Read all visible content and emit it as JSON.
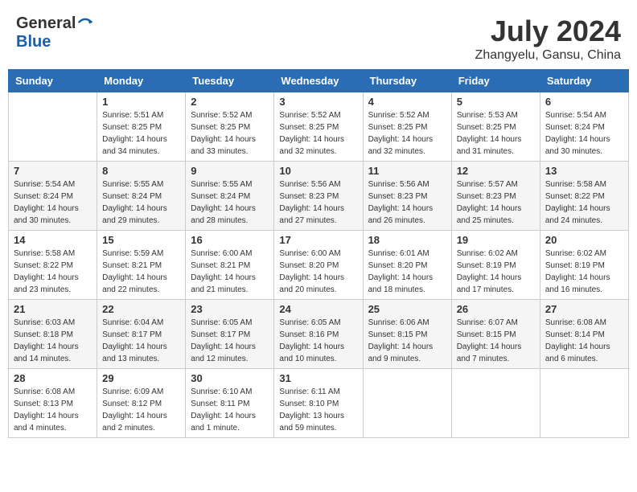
{
  "header": {
    "logo_general": "General",
    "logo_blue": "Blue",
    "title": "July 2024",
    "location": "Zhangyelu, Gansu, China"
  },
  "days_of_week": [
    "Sunday",
    "Monday",
    "Tuesday",
    "Wednesday",
    "Thursday",
    "Friday",
    "Saturday"
  ],
  "weeks": [
    [
      {
        "day": "",
        "info": ""
      },
      {
        "day": "1",
        "info": "Sunrise: 5:51 AM\nSunset: 8:25 PM\nDaylight: 14 hours\nand 34 minutes."
      },
      {
        "day": "2",
        "info": "Sunrise: 5:52 AM\nSunset: 8:25 PM\nDaylight: 14 hours\nand 33 minutes."
      },
      {
        "day": "3",
        "info": "Sunrise: 5:52 AM\nSunset: 8:25 PM\nDaylight: 14 hours\nand 32 minutes."
      },
      {
        "day": "4",
        "info": "Sunrise: 5:52 AM\nSunset: 8:25 PM\nDaylight: 14 hours\nand 32 minutes."
      },
      {
        "day": "5",
        "info": "Sunrise: 5:53 AM\nSunset: 8:25 PM\nDaylight: 14 hours\nand 31 minutes."
      },
      {
        "day": "6",
        "info": "Sunrise: 5:54 AM\nSunset: 8:24 PM\nDaylight: 14 hours\nand 30 minutes."
      }
    ],
    [
      {
        "day": "7",
        "info": "Sunrise: 5:54 AM\nSunset: 8:24 PM\nDaylight: 14 hours\nand 30 minutes."
      },
      {
        "day": "8",
        "info": "Sunrise: 5:55 AM\nSunset: 8:24 PM\nDaylight: 14 hours\nand 29 minutes."
      },
      {
        "day": "9",
        "info": "Sunrise: 5:55 AM\nSunset: 8:24 PM\nDaylight: 14 hours\nand 28 minutes."
      },
      {
        "day": "10",
        "info": "Sunrise: 5:56 AM\nSunset: 8:23 PM\nDaylight: 14 hours\nand 27 minutes."
      },
      {
        "day": "11",
        "info": "Sunrise: 5:56 AM\nSunset: 8:23 PM\nDaylight: 14 hours\nand 26 minutes."
      },
      {
        "day": "12",
        "info": "Sunrise: 5:57 AM\nSunset: 8:23 PM\nDaylight: 14 hours\nand 25 minutes."
      },
      {
        "day": "13",
        "info": "Sunrise: 5:58 AM\nSunset: 8:22 PM\nDaylight: 14 hours\nand 24 minutes."
      }
    ],
    [
      {
        "day": "14",
        "info": "Sunrise: 5:58 AM\nSunset: 8:22 PM\nDaylight: 14 hours\nand 23 minutes."
      },
      {
        "day": "15",
        "info": "Sunrise: 5:59 AM\nSunset: 8:21 PM\nDaylight: 14 hours\nand 22 minutes."
      },
      {
        "day": "16",
        "info": "Sunrise: 6:00 AM\nSunset: 8:21 PM\nDaylight: 14 hours\nand 21 minutes."
      },
      {
        "day": "17",
        "info": "Sunrise: 6:00 AM\nSunset: 8:20 PM\nDaylight: 14 hours\nand 20 minutes."
      },
      {
        "day": "18",
        "info": "Sunrise: 6:01 AM\nSunset: 8:20 PM\nDaylight: 14 hours\nand 18 minutes."
      },
      {
        "day": "19",
        "info": "Sunrise: 6:02 AM\nSunset: 8:19 PM\nDaylight: 14 hours\nand 17 minutes."
      },
      {
        "day": "20",
        "info": "Sunrise: 6:02 AM\nSunset: 8:19 PM\nDaylight: 14 hours\nand 16 minutes."
      }
    ],
    [
      {
        "day": "21",
        "info": "Sunrise: 6:03 AM\nSunset: 8:18 PM\nDaylight: 14 hours\nand 14 minutes."
      },
      {
        "day": "22",
        "info": "Sunrise: 6:04 AM\nSunset: 8:17 PM\nDaylight: 14 hours\nand 13 minutes."
      },
      {
        "day": "23",
        "info": "Sunrise: 6:05 AM\nSunset: 8:17 PM\nDaylight: 14 hours\nand 12 minutes."
      },
      {
        "day": "24",
        "info": "Sunrise: 6:05 AM\nSunset: 8:16 PM\nDaylight: 14 hours\nand 10 minutes."
      },
      {
        "day": "25",
        "info": "Sunrise: 6:06 AM\nSunset: 8:15 PM\nDaylight: 14 hours\nand 9 minutes."
      },
      {
        "day": "26",
        "info": "Sunrise: 6:07 AM\nSunset: 8:15 PM\nDaylight: 14 hours\nand 7 minutes."
      },
      {
        "day": "27",
        "info": "Sunrise: 6:08 AM\nSunset: 8:14 PM\nDaylight: 14 hours\nand 6 minutes."
      }
    ],
    [
      {
        "day": "28",
        "info": "Sunrise: 6:08 AM\nSunset: 8:13 PM\nDaylight: 14 hours\nand 4 minutes."
      },
      {
        "day": "29",
        "info": "Sunrise: 6:09 AM\nSunset: 8:12 PM\nDaylight: 14 hours\nand 2 minutes."
      },
      {
        "day": "30",
        "info": "Sunrise: 6:10 AM\nSunset: 8:11 PM\nDaylight: 14 hours\nand 1 minute."
      },
      {
        "day": "31",
        "info": "Sunrise: 6:11 AM\nSunset: 8:10 PM\nDaylight: 13 hours\nand 59 minutes."
      },
      {
        "day": "",
        "info": ""
      },
      {
        "day": "",
        "info": ""
      },
      {
        "day": "",
        "info": ""
      }
    ]
  ]
}
